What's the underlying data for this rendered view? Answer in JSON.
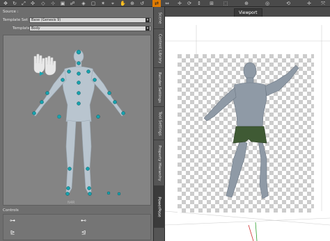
{
  "left_panel": {
    "source_label": "Source :",
    "template_set_label": "Template Set :",
    "template_set_value": "Base (Genesis 9)",
    "template_label": "Template :",
    "template_value": "Body",
    "figure_label": "N4R",
    "controls_label": "Controls"
  },
  "side_tabs": [
    {
      "label": "Scene"
    },
    {
      "label": "Content Library"
    },
    {
      "label": "Render Settings"
    },
    {
      "label": "Tool Settings"
    },
    {
      "label": "Property Hierarchy"
    },
    {
      "label": "PowerPose"
    }
  ],
  "viewport": {
    "tab_label": "Viewport"
  },
  "toolbar": {
    "icons": [
      "move-tool-icon",
      "rotate-tool-icon",
      "scale-tool-icon",
      "universal-tool-icon",
      "node-select-icon",
      "joint-editor-icon",
      "geometry-editor-icon",
      "active-pose-icon",
      "surface-selection-icon",
      "spot-render-icon",
      "light-tool-icon",
      "camera-tool-icon",
      "pan-tool-icon",
      "zoom-tool-icon",
      "orbit-tool-icon",
      "orange-pane-toggle-icon"
    ]
  },
  "colors": {
    "accent_orange": "#e07b00",
    "pose_node": "#16a3ad",
    "panel_gray": "#6e6e6e"
  }
}
